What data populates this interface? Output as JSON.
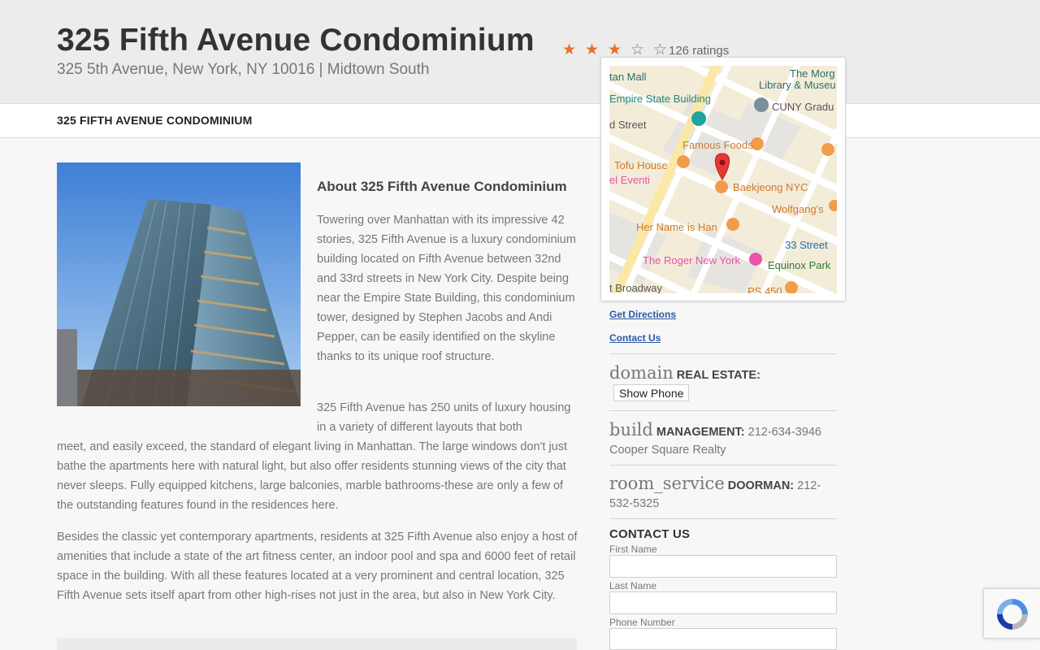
{
  "header": {
    "title": "325 Fifth Avenue Condominium",
    "address": "325 5th Avenue, New York, NY 10016 | Midtown South",
    "rating_stars": 3,
    "rating_max": 5,
    "ratings_text": "126 ratings"
  },
  "subnav": {
    "title": "325 FIFTH AVENUE CONDOMINIUM"
  },
  "about": {
    "heading": "About 325 Fifth Avenue Condominium",
    "p1": "Towering over Manhattan with its impressive 42 stories, 325 Fifth Avenue is a luxury condominium building located on Fifth Avenue between 32nd and 33rd streets in New York City. Despite being near the Empire State Building, this condominium tower, designed by Stephen Jacobs and Andi Pepper, can be easily identified on the skyline thanks to its unique roof structure.",
    "p2_start": "325 Fifth Avenue has 250 units of luxury housing in a variety of different layouts that both",
    "p2_rest": "meet, and easily exceed, the standard of elegant living in Manhattan. The large windows don't just bathe the apartments here with natural light, but also offer residents stunning views of the city that never sleeps. Fully equipped kitchens, large balconies, marble bathrooms-these are only a few of the outstanding features found in the residences here.",
    "p3": "Besides the classic yet contemporary apartments, residents at 325 Fifth Avenue also enjoy a host of amenities that include a state of the art fitness center, an indoor pool and spa and 6000 feet of retail space in the building. With all these features located at a very prominent and central location, 325 Fifth Avenue sets itself apart from other high-rises not just in the area, but also in New York City."
  },
  "map": {
    "labels": {
      "mall": "tan Mall",
      "library": "The Morg",
      "library2": "Library & Museu",
      "empire": "Empire State Building",
      "cuny": "CUNY Gradu",
      "street": "d Street",
      "famous": "Famous Foods",
      "tofu": "Tofu House",
      "eventi": "el Eventi",
      "baekjeong": "Baekjeong NYC",
      "wolfgang": "Wolfgang's",
      "hername": "Her Name is Han",
      "st33": "33 Street",
      "roger": "The Roger New York",
      "equinox": "Equinox Park",
      "broadway": "t Broadway",
      "ps450": "PS 450"
    }
  },
  "sidebar": {
    "get_directions": "Get Directions",
    "contact_us_link": "Contact Us",
    "real_estate_icon": "domain",
    "real_estate_label": "REAL ESTATE:",
    "show_phone": "Show Phone",
    "management_icon": "build",
    "management_label": "MANAGEMENT:",
    "management_phone": "212-634-3946",
    "management_company": "Cooper Square Realty",
    "doorman_icon": "room_service",
    "doorman_label": "DOORMAN:",
    "doorman_phone": "212-532-5325",
    "contact_heading": "CONTACT US",
    "first_name": "First Name",
    "last_name": "Last Name",
    "phone_number": "Phone Number"
  },
  "colors": {
    "star": "#e8702a",
    "link": "#2b59a8",
    "header_bg": "#ececec"
  }
}
